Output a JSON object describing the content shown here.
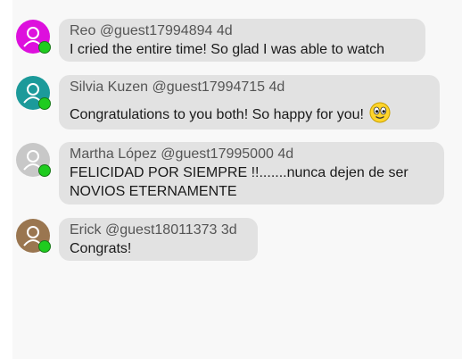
{
  "comments": [
    {
      "name": "Reo",
      "handle": "@guest17994894",
      "time": "4d",
      "text": "I cried the entire time! So glad I was able to watch",
      "avatar_color": "#dd10dd",
      "online": true
    },
    {
      "name": "Silvia Kuzen",
      "handle": "@guest17994715",
      "time": "4d",
      "text": "Congratulations to you both! So happy for you!",
      "emoji": "smiley-emoji",
      "avatar_color": "#1c9a9a",
      "online": true
    },
    {
      "name": "Martha López",
      "handle": "@guest17995000",
      "time": "4d",
      "text_line1": "FELICIDAD POR SIEMPRE !!.......nunca dejen de ser",
      "text_line2": "NOVIOS ETERNAMENTE",
      "avatar_color": "#c8c8c8",
      "online": true
    },
    {
      "name": "Erick",
      "handle": "@guest18011373",
      "time": "3d",
      "text": "Congrats!",
      "avatar_color": "#9a7650",
      "online": true
    }
  ]
}
